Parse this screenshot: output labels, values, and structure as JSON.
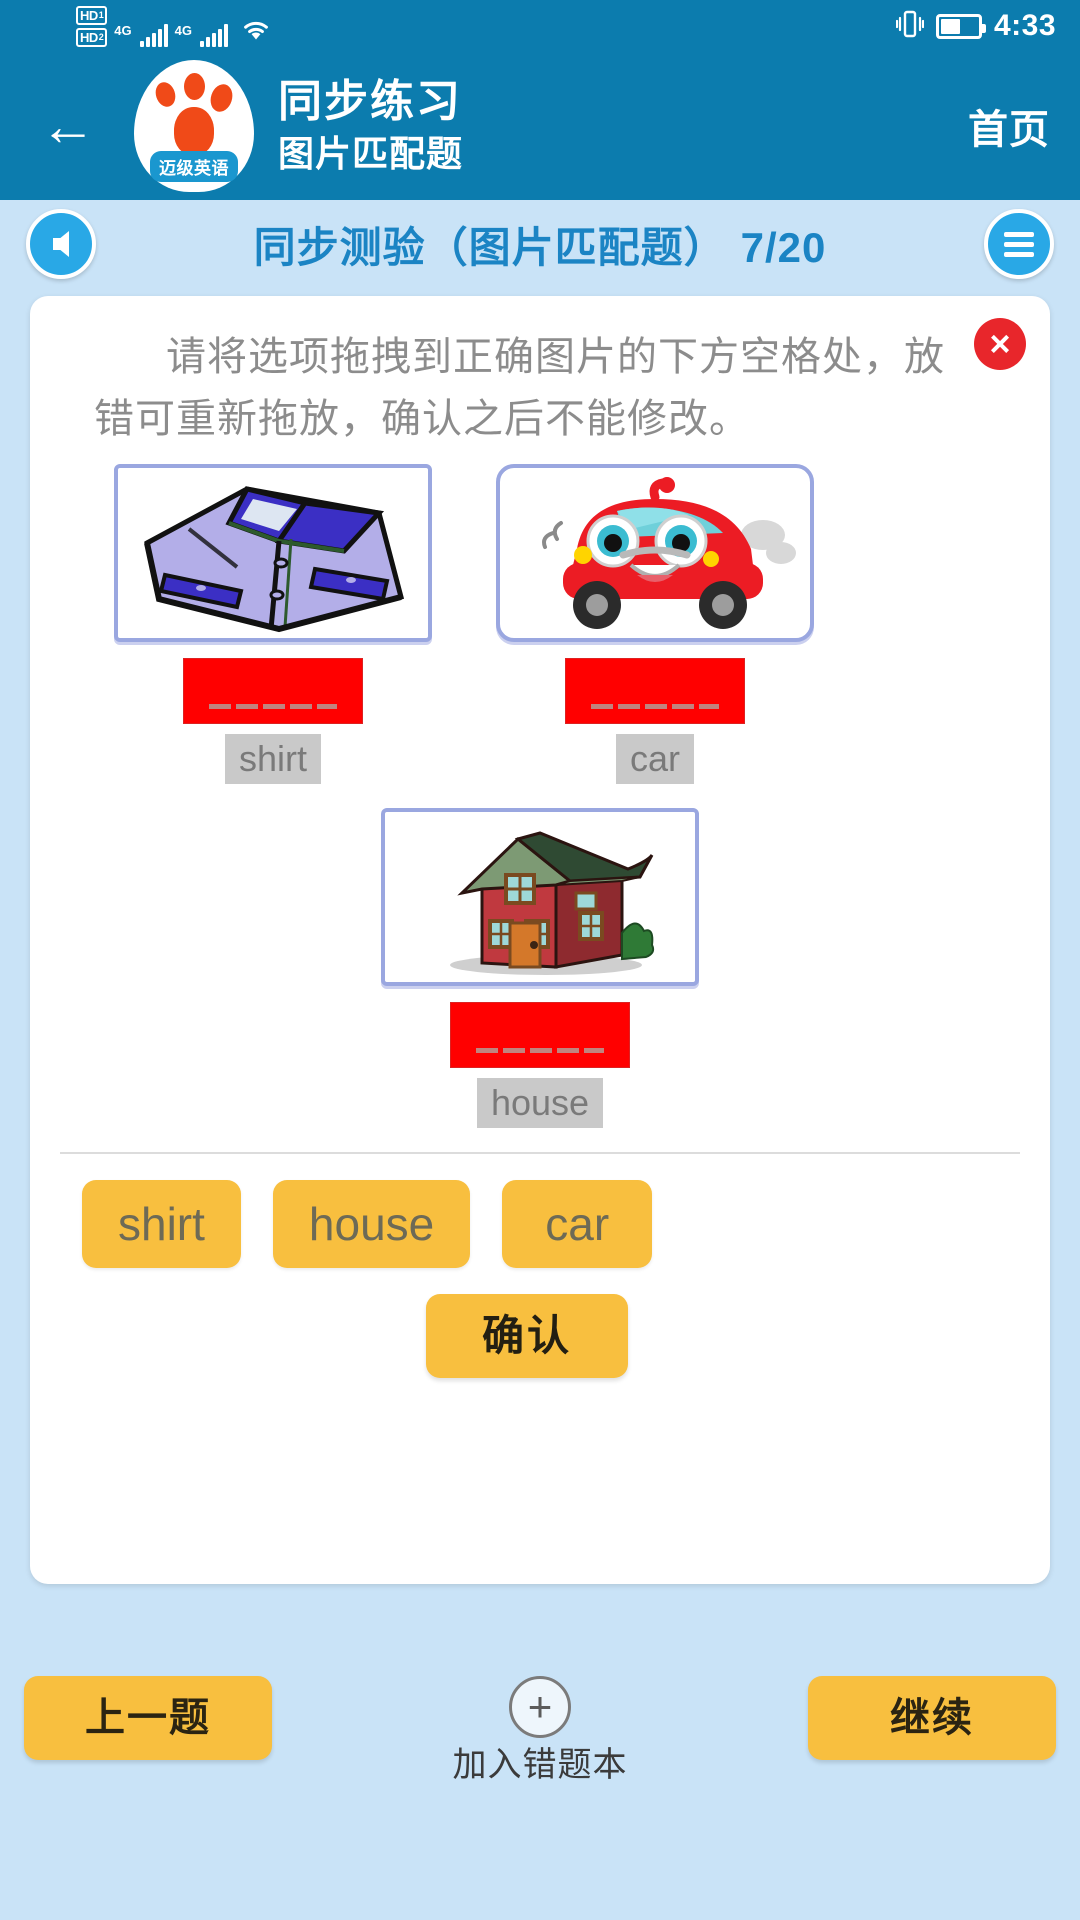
{
  "statusbar": {
    "hd1": "HD",
    "hd1_sub": "1",
    "hd2": "HD",
    "hd2_sub": "2",
    "net1": "4G",
    "net2": "4G",
    "time": "4:33",
    "icons": [
      "hd-sim1-icon",
      "hd-sim2-icon",
      "signal-bars-icon",
      "wifi-icon",
      "vibrate-icon",
      "battery-icon"
    ]
  },
  "appbar": {
    "back_icon": "back-arrow-icon",
    "logo_tag": "迈级英语",
    "title_main": "同步练习",
    "title_sub": "图片匹配题",
    "home_label": "首页"
  },
  "quizbar": {
    "back_icon": "circle-back-arrow-icon",
    "title": "同步测验（图片匹配题）",
    "progress": "7/20",
    "menu_icon": "hamburger-menu-icon"
  },
  "card": {
    "close_icon": "×",
    "instructions": "请将选项拖拽到正确图片的下方空格处，放错可重新拖放，确认之后不能修改。"
  },
  "questions": [
    {
      "image": "shirt-image",
      "answer": "shirt"
    },
    {
      "image": "car-image",
      "answer": "car"
    },
    {
      "image": "house-image",
      "answer": "house"
    }
  ],
  "wordbank": {
    "chips": [
      "shirt",
      "house",
      "car"
    ],
    "confirm_label": "确认"
  },
  "footer": {
    "prev_label": "上一题",
    "add_icon": "plus-circle-icon",
    "add_label": "加入错题本",
    "next_label": "继续"
  },
  "colors": {
    "header_blue": "#0c7cae",
    "page_blue": "#c9e3f7",
    "accent_yellow": "#f8bf3f",
    "slot_red": "#ff0000",
    "title_blue": "#1b84c4"
  }
}
